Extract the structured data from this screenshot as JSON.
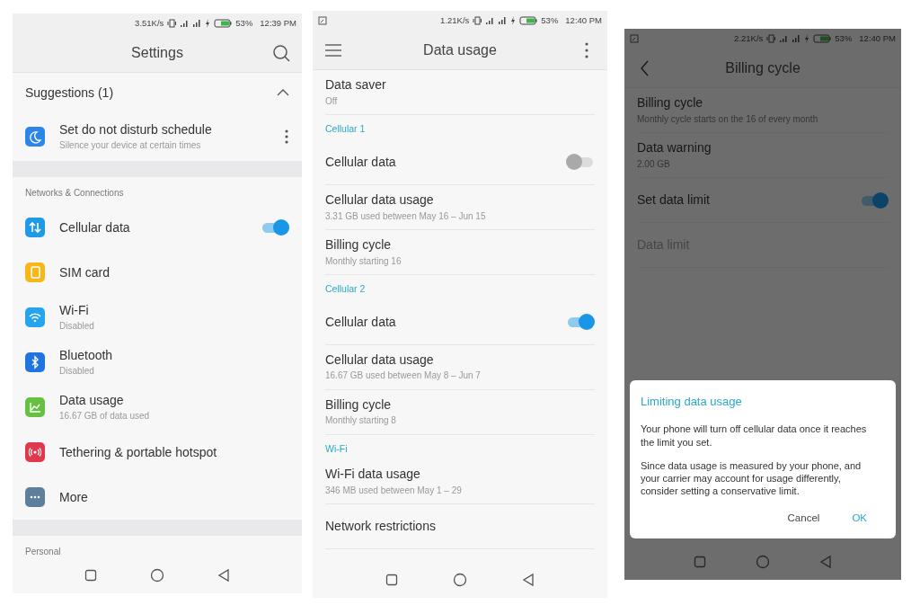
{
  "panels": [
    {
      "dimmed": false,
      "status_bar": {
        "screenshot_notification": false,
        "speed": "3.51K/s",
        "battery": "53%",
        "time": "12:39 PM"
      },
      "app_bar": {
        "title": "Settings",
        "trailing": {
          "kind": "search"
        }
      },
      "rows": [
        {
          "kind": "group_header",
          "title": "Suggestions (1)",
          "expanded": true
        },
        {
          "kind": "suggestion",
          "title": "Set do not disturb schedule",
          "subtitle": "Silence your device at certain times",
          "color": "#2b86e8"
        },
        {
          "kind": "gap"
        },
        {
          "kind": "section_label",
          "title": "Networks & Connections"
        },
        {
          "kind": "item",
          "title": "Cellular data",
          "color": "#1e9ae8",
          "on": true
        },
        {
          "kind": "item",
          "title": "SIM card",
          "color": "#f7b718"
        },
        {
          "kind": "item",
          "title": "Wi-Fi",
          "subtitle": "Disabled",
          "color": "#27a4ee"
        },
        {
          "kind": "item",
          "title": "Bluetooth",
          "subtitle": "Disabled",
          "color": "#1f74e0"
        },
        {
          "kind": "item",
          "title": "Data usage",
          "subtitle": "16.67 GB of data used",
          "color": "#66c142"
        },
        {
          "kind": "item",
          "title": "Tethering & portable hotspot",
          "color": "#e0394d"
        },
        {
          "kind": "item",
          "title": "More",
          "color": "#5d7f9c"
        },
        {
          "kind": "gap"
        },
        {
          "kind": "section_label",
          "title": "Personal"
        }
      ]
    },
    {
      "dimmed": false,
      "status_bar": {
        "screenshot_notification": true,
        "speed": "1.21K/s",
        "battery": "53%",
        "time": "12:40 PM"
      },
      "app_bar": {
        "title": "Data usage",
        "leading": {
          "kind": "menu"
        },
        "trailing": {
          "kind": "more"
        }
      },
      "rows": [
        {
          "kind": "item",
          "title": "Data saver",
          "subtitle": "Off"
        },
        {
          "kind": "category",
          "title": "Cellular 1"
        },
        {
          "kind": "item",
          "title": "Cellular data",
          "on": false
        },
        {
          "kind": "item",
          "title": "Cellular data usage",
          "subtitle": "3.31 GB used between May 16 – Jun 15"
        },
        {
          "kind": "item",
          "title": "Billing cycle",
          "subtitle": "Monthly starting 16"
        },
        {
          "kind": "category",
          "title": "Cellular 2"
        },
        {
          "kind": "item",
          "title": "Cellular data",
          "on": true
        },
        {
          "kind": "item",
          "title": "Cellular data usage",
          "subtitle": "16.67 GB used between May 8 – Jun 7"
        },
        {
          "kind": "item",
          "title": "Billing cycle",
          "subtitle": "Monthly starting 8"
        },
        {
          "kind": "category",
          "title": "Wi-Fi"
        },
        {
          "kind": "item",
          "title": "Wi-Fi data usage",
          "subtitle": "346 MB used between May 1 – 29"
        },
        {
          "kind": "item",
          "title": "Network restrictions"
        }
      ]
    },
    {
      "dimmed": true,
      "status_bar": {
        "screenshot_notification": true,
        "speed": "2.21K/s",
        "battery": "53%",
        "time": "12:40 PM"
      },
      "app_bar": {
        "title": "Billing cycle",
        "leading": {
          "kind": "back"
        }
      },
      "rows": [
        {
          "kind": "item",
          "title": "Billing cycle",
          "subtitle": "Monthly cycle starts on the 16 of every month",
          "disabled": false
        },
        {
          "kind": "item",
          "title": "Data warning",
          "subtitle": "2.00 GB",
          "disabled": false
        },
        {
          "kind": "item",
          "title": "Set data limit",
          "on": true,
          "disabled": false
        },
        {
          "kind": "item",
          "title": "Data limit",
          "disabled": true
        }
      ],
      "dialog": {
        "title": "Limiting data usage",
        "paragraphs": [
          "Your phone will turn off cellular data once it reaches the limit you set.",
          "Since data usage is measured by your phone, and your carrier may account for usage differently, consider setting a conservative limit."
        ],
        "buttons": [
          {
            "label": "Cancel",
            "primary": false
          },
          {
            "label": "OK",
            "primary": true
          }
        ]
      }
    }
  ]
}
